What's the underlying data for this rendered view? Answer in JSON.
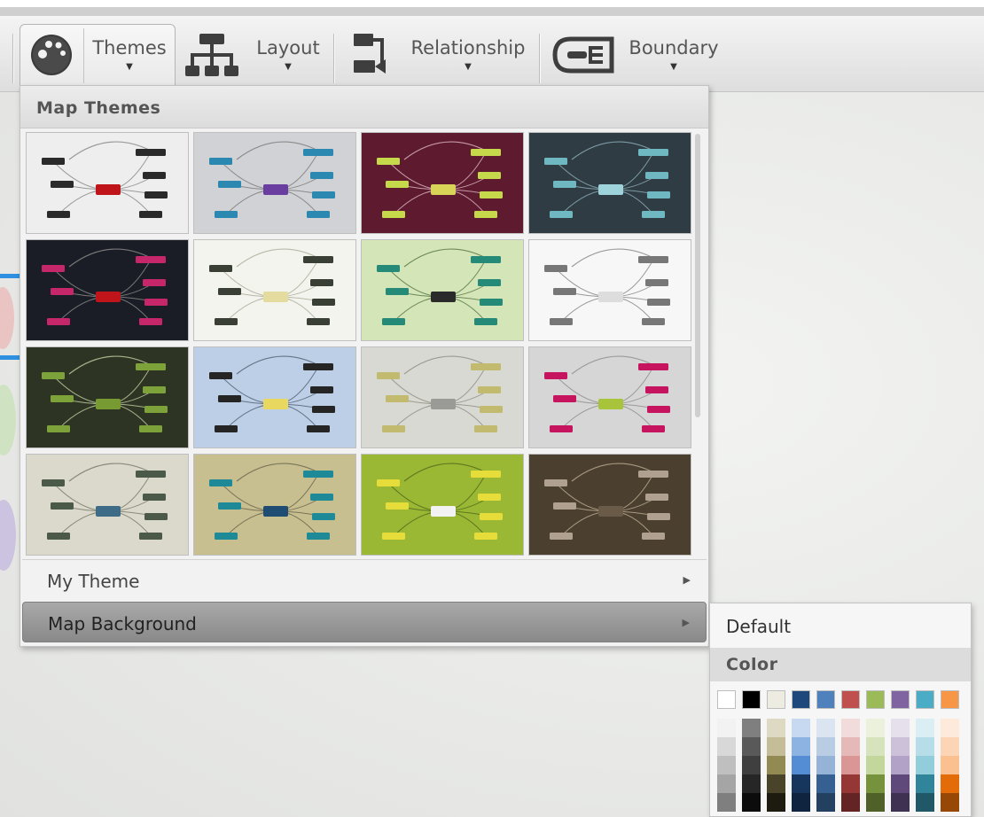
{
  "toolbar": {
    "themes_label": "Themes",
    "layout_label": "Layout",
    "relationship_label": "Relationship",
    "boundary_label": "Boundary"
  },
  "dropdown": {
    "header": "Map Themes",
    "my_theme_label": "My Theme",
    "map_background_label": "Map Background"
  },
  "themes": [
    {
      "bg": "#eeeeee",
      "fg": "#2a2a2a",
      "center": "#c0141b",
      "line": "#9a9a9a"
    },
    {
      "bg": "#d0d2d6",
      "fg": "#2b88b0",
      "center": "#6a3ea0",
      "line": "#8a8a8a"
    },
    {
      "bg": "#5e1a2e",
      "fg": "#c6d94a",
      "center": "#d8d458",
      "line": "#c69aa8"
    },
    {
      "bg": "#2f3c44",
      "fg": "#6fb8c2",
      "center": "#9fd3dc",
      "line": "#7d9aa4"
    },
    {
      "bg": "#1b1d26",
      "fg": "#c6266a",
      "center": "#c0141b",
      "line": "#777777"
    },
    {
      "bg": "#f4f4ef",
      "fg": "#3a3f35",
      "center": "#e4dc9e",
      "line": "#b8b8a8"
    },
    {
      "bg": "#d4e6b8",
      "fg": "#268a78",
      "center": "#2a2a2a",
      "line": "#6f8a5a"
    },
    {
      "bg": "#f7f7f7",
      "fg": "#777777",
      "center": "#dddddd",
      "line": "#9a9a9a"
    },
    {
      "bg": "#2e3424",
      "fg": "#7ea23a",
      "center": "#789a32",
      "line": "#a7b48a"
    },
    {
      "bg": "#bccfe6",
      "fg": "#252525",
      "center": "#e8d860",
      "line": "#667386"
    },
    {
      "bg": "#d9d9d4",
      "fg": "#c2ba6e",
      "center": "#9a9a96",
      "line": "#9b9b90"
    },
    {
      "bg": "#d6d6d6",
      "fg": "#c6145e",
      "center": "#a8c43a",
      "line": "#9a9a9a"
    },
    {
      "bg": "#dad9cc",
      "fg": "#4b5a48",
      "center": "#3e6b86",
      "line": "#8a8a7a"
    },
    {
      "bg": "#c7bf90",
      "fg": "#1e8a98",
      "center": "#1e4c72",
      "line": "#7a7458"
    },
    {
      "bg": "#9ab834",
      "fg": "#e6dc3a",
      "center": "#f2f2f2",
      "line": "#5d7720"
    },
    {
      "bg": "#4b4030",
      "fg": "#b0a090",
      "center": "#6a5a48",
      "line": "#a89a80"
    }
  ],
  "submenu": {
    "default_label": "Default",
    "color_header": "Color",
    "base_colors": [
      "#ffffff",
      "#000000",
      "#eeece1",
      "#1f497d",
      "#4f81bd",
      "#c0504d",
      "#9bbb59",
      "#8064a2",
      "#4bacc6",
      "#f79646"
    ],
    "shades": [
      [
        "#f2f2f2",
        "#d8d8d8",
        "#bfbfbf",
        "#a5a5a5",
        "#7f7f7f"
      ],
      [
        "#7f7f7f",
        "#595959",
        "#3f3f3f",
        "#262626",
        "#0c0c0c"
      ],
      [
        "#ddd9c3",
        "#c4bd97",
        "#938953",
        "#494429",
        "#1d1b10"
      ],
      [
        "#c6d9f0",
        "#8db3e2",
        "#548dd4",
        "#17365d",
        "#0f243e"
      ],
      [
        "#dbe5f1",
        "#b8cce4",
        "#95b3d7",
        "#366092",
        "#244061"
      ],
      [
        "#f2dcdb",
        "#e5b9b7",
        "#d99694",
        "#953734",
        "#632423"
      ],
      [
        "#ebf1dd",
        "#d7e3bc",
        "#c3d69b",
        "#76923c",
        "#4f6128"
      ],
      [
        "#e5e0ec",
        "#ccc1d9",
        "#b2a2c7",
        "#5f497a",
        "#3f3151"
      ],
      [
        "#dbeef3",
        "#b7dde8",
        "#92cddc",
        "#31859b",
        "#205867"
      ],
      [
        "#fdeada",
        "#fbd5b5",
        "#fac08f",
        "#e36c09",
        "#974806"
      ]
    ]
  }
}
